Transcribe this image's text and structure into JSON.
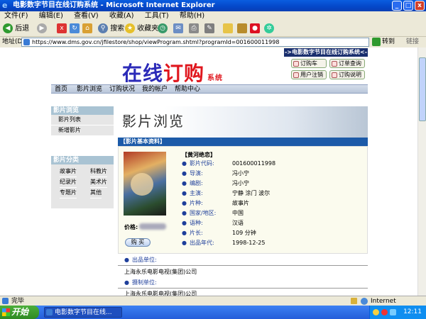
{
  "window": {
    "title": "电影数字节目在线订购系统 - Microsoft Internet Explorer"
  },
  "menu": [
    "文件(F)",
    "编辑(E)",
    "查看(V)",
    "收藏(A)",
    "工具(T)",
    "帮助(H)"
  ],
  "toolbar": {
    "back": "后退",
    "search": "搜索",
    "favorites": "收藏夹"
  },
  "address": {
    "label": "地址(D)",
    "url": "https://www.dms.gov.cn/jfilestore/shop/viewProgram.shtml?programId=001600011998",
    "go": "转到",
    "links": "链接"
  },
  "page": {
    "logo_text_a": "在线",
    "logo_text_b": "订购",
    "logo_suffix": "系统",
    "sys_banner": "->电影数字节目在线订购系统<-",
    "header_buttons": [
      "订购车",
      "订单查询",
      "用户注销",
      "订购说明"
    ],
    "nav": [
      "首页",
      "影片浏览",
      "订购状况",
      "我的帐户",
      "帮助中心"
    ],
    "side1": {
      "title": "影片浏览",
      "items": [
        "影片列表",
        "新增影片"
      ]
    },
    "side2": {
      "title": "影片分类",
      "items": [
        "故事片",
        "科教片",
        "纪录片",
        "美术片",
        "专题片",
        "其他"
      ]
    },
    "banner_title": "影片浏览",
    "info_header": "【影片基本资料】",
    "movie_title": "【黄河绝恋】",
    "fields": [
      {
        "label": "影片代码:",
        "value": "001600011998"
      },
      {
        "label": "导演:",
        "value": "冯小宁"
      },
      {
        "label": "编剧:",
        "value": "冯小宁"
      },
      {
        "label": "主演:",
        "value": "宁静 涂门 波尔"
      },
      {
        "label": "片种:",
        "value": "故事片"
      },
      {
        "label": "国家/地区:",
        "value": "中国"
      },
      {
        "label": "语种:",
        "value": "汉语"
      },
      {
        "label": "片长:",
        "value": "109 分钟"
      },
      {
        "label": "出品年代:",
        "value": "1998-12-25"
      }
    ],
    "price_label": "价格:",
    "buy_button": "购 买",
    "producer_label": "出品单位:",
    "producer_value": "上海永乐电影电视(集团)公司",
    "made_label": "摄制单位:",
    "made_value": "上海永乐电影电视(集团)公司"
  },
  "status": {
    "left": "完毕",
    "zone": "Internet"
  },
  "taskbar": {
    "start": "开始",
    "task": "电影数字节目在线...",
    "clock": "12:11"
  }
}
